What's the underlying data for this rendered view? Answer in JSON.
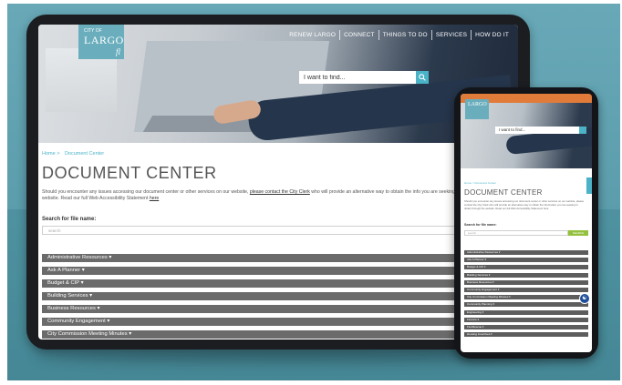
{
  "tablet": {
    "nav": [
      "RENEW LARGO",
      "CONNECT",
      "THINGS TO DO",
      "SERVICES",
      "HOW DO IT"
    ],
    "logo": {
      "city": "CITY OF",
      "name": "LARGO",
      "suffix": "fl"
    },
    "search_placeholder": "I want to find...",
    "breadcrumb": [
      "Home >",
      "Document Center"
    ],
    "title": "DOCUMENT CENTER",
    "intro_before": "Should you encounter any issues accessing our document center or other services on our website, ",
    "intro_link": "please contact the City Clerk",
    "intro_middle": " who will provide an alternative way to obtain the info you are seeking to obtain through the website. Read our full Web Accessibility Statement ",
    "intro_here": "here",
    "search_label": "Search for file name:",
    "file_placeholder": "search",
    "categories": [
      "Administrative Resources ▾",
      "Ask A Planner ▾",
      "Budget & CIP ▾",
      "Building Services ▾",
      "Business Resources ▾",
      "Community Engagement ▾",
      "City Commission Meeting Minutes ▾"
    ]
  },
  "phone": {
    "logo_name": "LARGO",
    "search_placeholder": "I want to find...",
    "breadcrumb": "Home > Document Center",
    "title": "DOCUMENT CENTER",
    "intro": "Should you encounter any issues accessing our document center or other services on our website, please contact the City Clerk who will provide an alternative way to obtain the information you are seeking to obtain through the website. Read our full Web Accessibility Statement here",
    "search_label": "Search for file name:",
    "file_placeholder": "search",
    "search_button": "SEARCH",
    "categories": [
      "Administrative Resources ▾",
      "Ask A Planner ▾",
      "Budget & CIP ▾",
      "Building Services ▾",
      "Business Resources ▾",
      "Community Engagement ▾",
      "City Commission Meeting Minutes ▾",
      "Community Planning ▾",
      "Engineering ▾",
      "Finance ▾",
      "Fire/Rescue ▾",
      "Housing Incentives ▾"
    ]
  },
  "colors": {
    "accent": "#4bb3c7",
    "bar": "#6b6b6b",
    "search_button": "#93c13e",
    "background": "#5c9dac"
  },
  "icons": {
    "search": "search-icon",
    "accessibility": "accessibility-icon"
  }
}
